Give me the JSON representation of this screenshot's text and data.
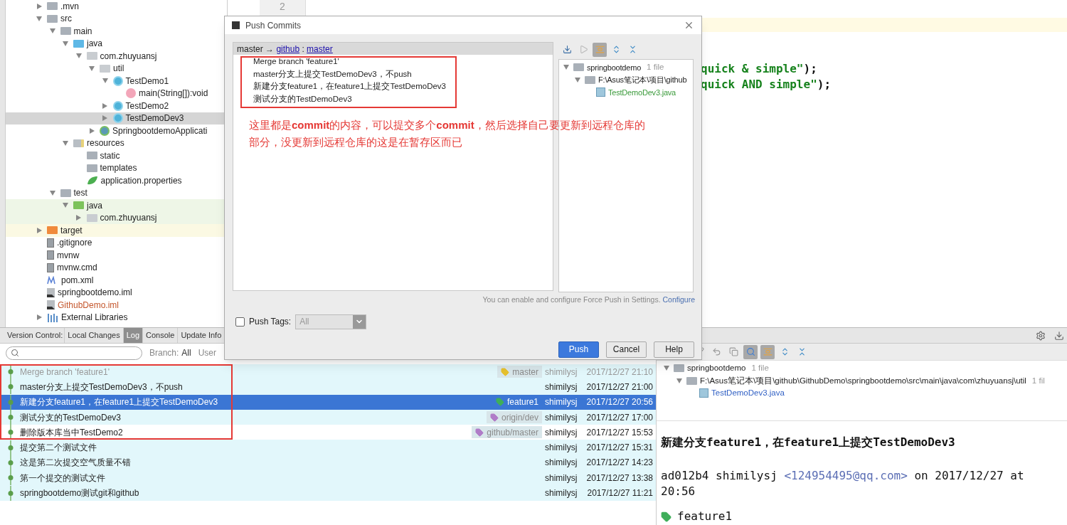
{
  "project_tree": {
    "items": [
      {
        "label": ".mvn",
        "kind": "folder",
        "expanded": false,
        "selected": false
      },
      {
        "label": "src",
        "kind": "folder",
        "expanded": true,
        "selected": false,
        "children": [
          {
            "label": "main",
            "kind": "folder",
            "expanded": true,
            "selected": false,
            "children": [
              {
                "label": "java",
                "kind": "source-folder",
                "expanded": true,
                "selected": false,
                "children": [
                  {
                    "label": "com.zhuyuansj",
                    "kind": "package",
                    "expanded": true,
                    "selected": false,
                    "children": [
                      {
                        "label": "util",
                        "kind": "package",
                        "expanded": true,
                        "selected": false,
                        "children": [
                          {
                            "label": "TestDemo1",
                            "kind": "class",
                            "expanded": true,
                            "selected": false,
                            "children": [
                              {
                                "label": "main(String[]):void",
                                "kind": "method",
                                "selected": false
                              }
                            ]
                          },
                          {
                            "label": "TestDemo2",
                            "kind": "class",
                            "expanded": false,
                            "selected": false
                          },
                          {
                            "label": "TestDemoDev3",
                            "kind": "class",
                            "expanded": false,
                            "selected": true
                          }
                        ]
                      },
                      {
                        "label": "SpringbootdemoApplicati",
                        "kind": "spring-class",
                        "expanded": false,
                        "selected": false
                      }
                    ]
                  }
                ]
              },
              {
                "label": "resources",
                "kind": "resources-folder",
                "expanded": true,
                "selected": false,
                "children": [
                  {
                    "label": "static",
                    "kind": "folder",
                    "selected": false
                  },
                  {
                    "label": "templates",
                    "kind": "folder",
                    "selected": false
                  },
                  {
                    "label": "application.properties",
                    "kind": "spring-properties",
                    "selected": false
                  }
                ]
              }
            ]
          },
          {
            "label": "test",
            "kind": "folder",
            "expanded": true,
            "selected": false,
            "children": [
              {
                "label": "java",
                "kind": "test-folder",
                "expanded": true,
                "selected": false,
                "children": [
                  {
                    "label": "com.zhuyuansj",
                    "kind": "test-package",
                    "expanded": false,
                    "selected": false
                  }
                ]
              }
            ]
          }
        ]
      },
      {
        "label": "target",
        "kind": "excluded-folder",
        "expanded": false,
        "selected": false
      },
      {
        "label": ".gitignore",
        "kind": "file",
        "selected": false
      },
      {
        "label": "mvnw",
        "kind": "file",
        "selected": false
      },
      {
        "label": "mvnw.cmd",
        "kind": "file",
        "selected": false
      },
      {
        "label": "pom.xml",
        "kind": "maven",
        "selected": false
      },
      {
        "label": "springbootdemo.iml",
        "kind": "module",
        "selected": false
      },
      {
        "label": "GithubDemo.iml",
        "kind": "unversioned-module",
        "selected": false
      },
      {
        "label": "External Libraries",
        "kind": "library",
        "expanded": false,
        "selected": false
      }
    ]
  },
  "editor": {
    "line_numbers": [
      "2"
    ],
    "lines": [
      {
        "tokens": [
          {
            "kind": "string",
            "text": "quick & simple\""
          },
          {
            "kind": "plain",
            "text": ");"
          }
        ]
      },
      {
        "tokens": [
          {
            "kind": "string",
            "text": "quick AND simple\""
          },
          {
            "kind": "plain",
            "text": ");"
          }
        ]
      }
    ]
  },
  "push_dialog": {
    "title": "Push Commits",
    "target": {
      "source": "master",
      "arrow": "→",
      "remote": "github",
      "separator": ":",
      "branch": "master"
    },
    "commits": [
      "Merge branch 'feature1'",
      "master分支上提交TestDemoDev3，不push",
      "新建分支feature1，在feature1上提交TestDemoDev3",
      "测试分支的TestDemoDev3"
    ],
    "annotation": "这里都是**commit**的内容，可以提交多个**commit**，然后选择自己要更新到远程仓库的部分，没更新到远程仓库的这是在暂存区而已",
    "changes": [
      {
        "label": "springbootdemo",
        "kind": "module-folder",
        "count": "1 file",
        "expanded": true,
        "children": [
          {
            "label": "F:\\Asus笔记本\\项目\\github",
            "kind": "folder",
            "expanded": true,
            "children": [
              {
                "label": "TestDemoDev3.java",
                "kind": "added-file"
              }
            ]
          }
        ]
      }
    ],
    "force_note": {
      "text": "You can enable and configure Force Push in Settings.",
      "link": "Configure"
    },
    "push_tags": {
      "label": "Push Tags:",
      "checked": false,
      "value": "All"
    },
    "buttons": [
      {
        "label": "Push",
        "kind": "default"
      },
      {
        "label": "Cancel",
        "kind": "normal"
      },
      {
        "label": "Help",
        "kind": "normal"
      }
    ]
  },
  "vcs_panel": {
    "title": "Version Control:",
    "tabs": [
      {
        "label": "Local Changes",
        "selected": false
      },
      {
        "label": "Log",
        "selected": true
      },
      {
        "label": "Console",
        "selected": false
      },
      {
        "label": "Update Info",
        "selected": false
      }
    ],
    "filter": {
      "branch_label": "Branch:",
      "branch_value": "All",
      "user_label": "User"
    },
    "commits": [
      {
        "subject": "Merge branch 'feature1'",
        "dimmed": true,
        "highlighted": true,
        "selected": false,
        "tags": [
          {
            "label": "master",
            "color": "#e6c12e"
          }
        ],
        "author": "shimilysj",
        "date": "2017/12/27 21:10"
      },
      {
        "subject": "master分支上提交TestDemoDev3，不push",
        "dimmed": false,
        "highlighted": true,
        "selected": false,
        "author": "shimilysj",
        "date": "2017/12/27 21:00"
      },
      {
        "subject": "新建分支feature1，在feature1上提交TestDemoDev3",
        "dimmed": false,
        "highlighted": true,
        "selected": true,
        "tags": [
          {
            "label": "feature1",
            "color": "#3fae5a"
          }
        ],
        "author": "shimilysj",
        "date": "2017/12/27 20:56"
      },
      {
        "subject": "测试分支的TestDemoDev3",
        "dimmed": false,
        "highlighted": true,
        "selected": false,
        "tags": [
          {
            "label": "origin/dev",
            "color": "#b07cc8"
          }
        ],
        "author": "shimilysj",
        "date": "2017/12/27 17:00"
      },
      {
        "subject": "删除版本库当中TestDemo2",
        "dimmed": false,
        "highlighted": false,
        "selected": false,
        "tags": [
          {
            "label": "github/master",
            "color": "#b07cc8"
          }
        ],
        "author": "shimilysj",
        "date": "2017/12/27 15:53"
      },
      {
        "subject": "提交第二个测试文件",
        "dimmed": false,
        "highlighted": true,
        "selected": false,
        "author": "shimilysj",
        "date": "2017/12/27 15:31"
      },
      {
        "subject": "这是第二次提交空气质量不错",
        "dimmed": false,
        "highlighted": true,
        "selected": false,
        "author": "shimilysj",
        "date": "2017/12/27 14:23"
      },
      {
        "subject": "第一个提交的测试文件",
        "dimmed": false,
        "highlighted": true,
        "selected": false,
        "author": "shimilysj",
        "date": "2017/12/27 13:38"
      },
      {
        "subject": "springbootdemo测试git和github",
        "dimmed": false,
        "highlighted": true,
        "selected": false,
        "author": "shimilysj",
        "date": "2017/12/27 11:21"
      }
    ],
    "changes": [
      {
        "label": "springbootdemo",
        "kind": "module-folder",
        "count": "1 file",
        "expanded": true,
        "children": [
          {
            "label": "F:\\Asus笔记本\\项目\\github\\GithubDemo\\springbootdemo\\src\\main\\java\\com\\zhuyuansj\\util",
            "kind": "folder",
            "count": "1 fil",
            "expanded": true,
            "children": [
              {
                "label": "TestDemoDev3.java",
                "kind": "modified-file"
              }
            ]
          }
        ]
      }
    ],
    "details": {
      "title": "新建分支feature1，在feature1上提交TestDemoDev3",
      "meta_before": "ad012b4 shimilysj",
      "email": "<124954495@qq.com>",
      "meta_after": "on 2017/12/27 at 20:56",
      "tags": [
        {
          "label": "feature1",
          "color": "#3fae5a"
        }
      ]
    }
  }
}
